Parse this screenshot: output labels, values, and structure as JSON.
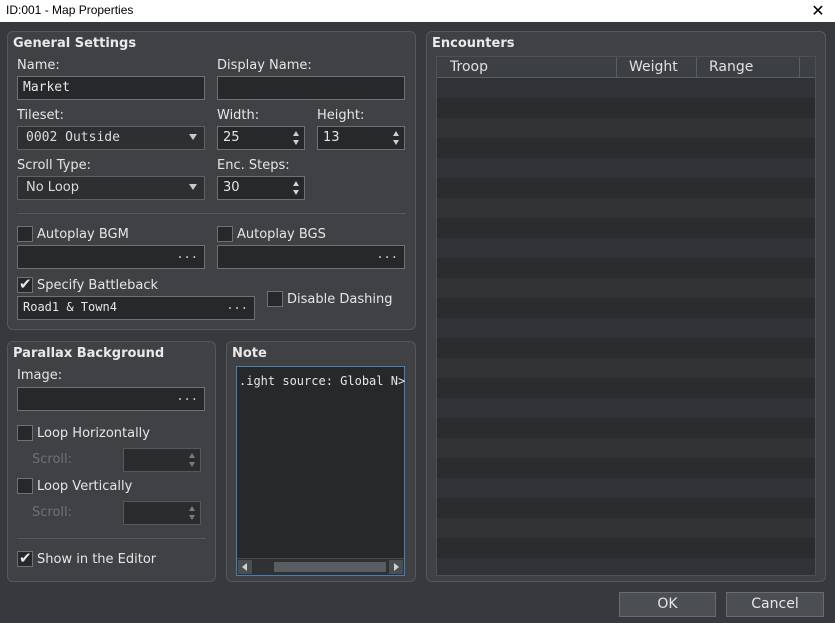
{
  "window": {
    "title": "ID:001 - Map Properties"
  },
  "general": {
    "title": "General Settings",
    "name_label": "Name:",
    "name_value": "Market",
    "display_name_label": "Display Name:",
    "display_name_value": "",
    "tileset_label": "Tileset:",
    "tileset_value": "0002 Outside",
    "width_label": "Width:",
    "width_value": "25",
    "height_label": "Height:",
    "height_value": "13",
    "scroll_type_label": "Scroll Type:",
    "scroll_type_value": "No Loop",
    "enc_steps_label": "Enc. Steps:",
    "enc_steps_value": "30",
    "autoplay_bgm_label": "Autoplay BGM",
    "autoplay_bgm_checked": false,
    "autoplay_bgs_label": "Autoplay BGS",
    "autoplay_bgs_checked": false,
    "specify_battleback_label": "Specify Battleback",
    "specify_battleback_checked": true,
    "battleback_value": "Road1 & Town4",
    "disable_dashing_label": "Disable Dashing",
    "disable_dashing_checked": false,
    "ellipsis": "..."
  },
  "parallax": {
    "title": "Parallax Background",
    "image_label": "Image:",
    "loop_h_label": "Loop Horizontally",
    "loop_v_label": "Loop Vertically",
    "scroll_label": "Scroll:",
    "show_editor_label": "Show in the Editor",
    "show_editor_checked": true
  },
  "note": {
    "title": "Note",
    "text": ".ight source: Global N>"
  },
  "encounters": {
    "title": "Encounters",
    "columns": [
      "Troop",
      "Weight",
      "Range"
    ],
    "rows": []
  },
  "buttons": {
    "ok": "OK",
    "cancel": "Cancel"
  },
  "icons": {
    "close": "close-icon",
    "check": "check-icon"
  }
}
